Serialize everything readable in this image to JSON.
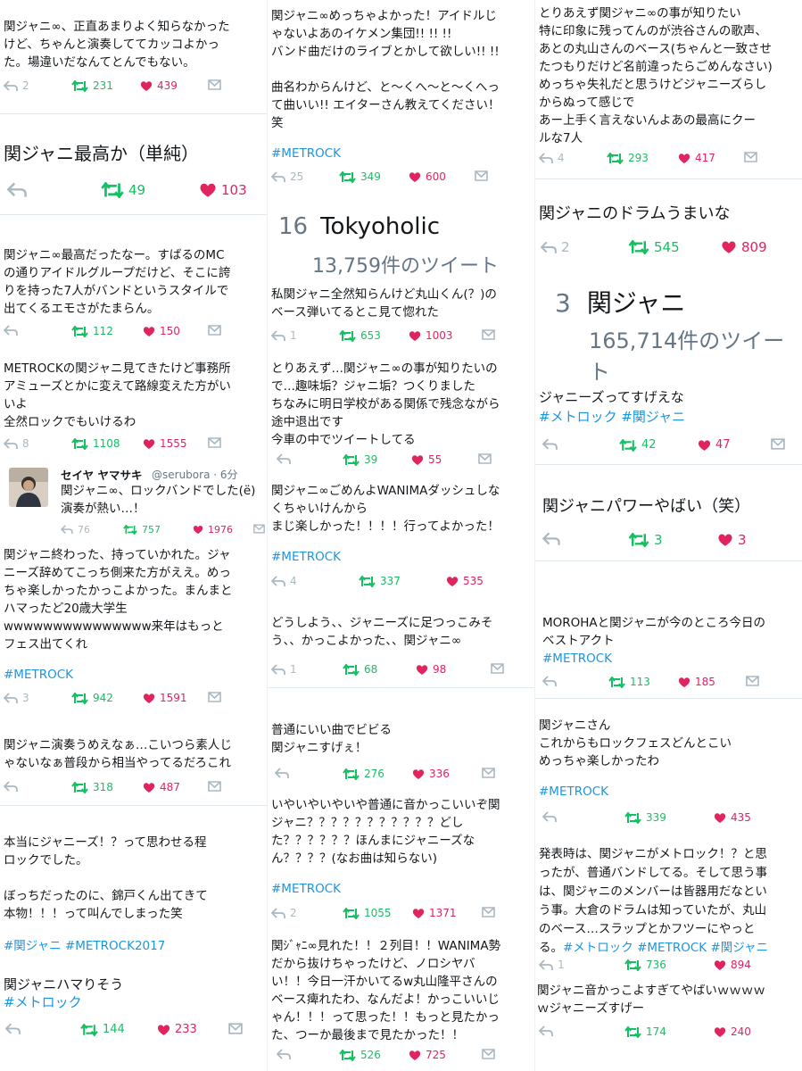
{
  "icons": {
    "reply": "reply-icon",
    "retweet": "retweet-icon",
    "like": "heart-icon",
    "dm": "envelope-icon"
  },
  "colors": {
    "retweet": "#17bf63",
    "like": "#e0245e",
    "hashtag": "#1b95e0",
    "muted": "#aab8c2"
  },
  "columns": [
    {
      "tweets": [
        {
          "text": "関ジャニ∞、正直あまりよく知らなかった\nけど、ちゃんと演奏しててカッコよかっ\nた。場違いだなんてとんでもない。",
          "hashtags": "",
          "reply": "2",
          "retweets": "231",
          "likes": "439"
        },
        {
          "text": "関ジャニ最高か（単純）",
          "hashtags": "",
          "reply": "",
          "retweets": "49",
          "likes": "103"
        },
        {
          "text": "関ジャニ∞最高だったなー。すばるのMC\nの通りアイドルグループだけど、そこに誇\nりを持った7人がバンドというスタイルで\n出てくるエモさがたまらん。",
          "hashtags": "",
          "reply": "",
          "retweets": "112",
          "likes": "150"
        },
        {
          "text": "METROCKの関ジャニ見てきたけど事務所\nアミューズとかに変えて路線変えた方がい\nいよ\n全然ロックでもいけるわ",
          "hashtags": "",
          "reply": "8",
          "retweets": "1108",
          "likes": "1555"
        },
        {
          "user_name": "セイヤ ヤマサキ",
          "user_handle": "@serubora · 6分",
          "text": "関ジャニ∞、ロックバンドでした(ё)\n演奏が熱い…！",
          "hashtags": "",
          "reply": "76",
          "retweets": "757",
          "likes": "1976"
        },
        {
          "text": "関ジャニ終わった、持っていかれた。ジャ\nニーズ辞めてこっち側来た方がええ。めっ\nちゃ楽しかったかっこよかった。まんまと\nハマったど20歳大学生\nwwwwwwwwwwwwwww来年はもっと\nフェス出てくれ",
          "hashtags": "#METROCK",
          "reply": "3",
          "retweets": "942",
          "likes": "1591"
        },
        {
          "text": "関ジャニ演奏うめえなぁ…こいつら素人じ\nゃないなぁ普段から相当やってるだろこれ",
          "hashtags": "",
          "reply": "",
          "retweets": "318",
          "likes": "487"
        },
        {
          "text": "本当にジャニーズ！？って思わせる程\nロックでした。\n\nぼっちだったのに、錦戸くん出てきて\n本物！！！って叫んでしまった笑",
          "hashtags": "#関ジャニ #METROCK2017",
          "reply": "",
          "retweets": "",
          "likes": ""
        },
        {
          "text": "関ジャニハマりそう",
          "hashtags": "#メトロック",
          "reply": "",
          "retweets": "144",
          "likes": "233"
        }
      ]
    },
    {
      "tweets": [
        {
          "text": "関ジャニ∞めっちゃよかった！アイドルじ\nゃないよあのイケメン集団!! !! !!\nバンド曲だけのライブとかして欲しい!! !!\n\n曲名わからんけど、と〜くへ〜と〜くへっ\nて曲いい!! エイターさん教えてください！\n笑",
          "hashtags": "#METROCK",
          "reply": "25",
          "retweets": "349",
          "likes": "600"
        },
        {
          "trend_rank": "16",
          "trend_name": "Tokyoholic",
          "trend_count": "13,759件のツイート"
        },
        {
          "text": "私関ジャニ全然知らんけど丸山くん(？)の\nベース弾いてるとこ見て惚れた",
          "hashtags": "",
          "reply": "1",
          "retweets": "653",
          "likes": "1003"
        },
        {
          "text": "とりあえず…関ジャニ∞の事が知りたいの\nで…趣味垢？ジャニ垢？つくりました\nちなみに明日学校がある関係で残念ながら\n途中退出です\n今車の中でツイートしてる",
          "hashtags": "",
          "reply": "",
          "retweets": "39",
          "likes": "55"
        },
        {
          "text": "関ジャニ∞ごめんよWANIMAダッシュしな\nくちゃいけんから\nまじ楽しかった！！！！行ってよかった！",
          "hashtags": "#METROCK",
          "reply": "4",
          "retweets": "337",
          "likes": "535"
        },
        {
          "text": "どうしよう、、ジャニーズに足つっこみそ\nう、、かっこよかった、、関ジャニ∞",
          "hashtags": "",
          "reply": "1",
          "retweets": "68",
          "likes": "98"
        },
        {
          "text": "普通にいい曲でビビる\n関ジャニすげぇ！",
          "hashtags": "",
          "reply": "",
          "retweets": "276",
          "likes": "336"
        },
        {
          "text": "いやいやいやいや普通に音かっこいいぞ関\nジャニ？？？？？？？？？？？どし\nた？？？？？？ほんまにジャニーズな\nん？？？？(なお曲は知らない)",
          "hashtags": "#METROCK",
          "reply": "2",
          "retweets": "1055",
          "likes": "1371"
        },
        {
          "text": "関ｼﾞｬﾆ∞見れた！！２列目！！WANIMA勢\nだから抜けちゃったけど、ノロシヤバ\nい！！今日一汗かいてるw丸山隆平さんの\nベース痺れたわ、なんだよ！かっこいいじ\nゃん！！！って思った！！もっと見たかっ\nた、つーか最後まで見たかった！！",
          "hashtags": "",
          "reply": "",
          "retweets": "526",
          "likes": "725"
        }
      ]
    },
    {
      "tweets": [
        {
          "text": "とりあえず関ジャニ∞の事が知りたい\n特に印象に残ってんのが渋谷さんの歌声、\nあとの丸山さんのベース(ちゃんと一致させ\nたつもりだけど名前違ったらごめんなさい)\nめっちゃ失礼だと思うけどジャニーズらし\nからぬって感じで\nあー上手く言えないんよあの最高にクー\nルな7人",
          "hashtags": "",
          "reply": "4",
          "retweets": "293",
          "likes": "417"
        },
        {
          "text": "関ジャニのドラムうまいな",
          "hashtags": "",
          "reply": "2",
          "retweets": "545",
          "likes": "809"
        },
        {
          "trend_rank": "3",
          "trend_name": "関ジャニ",
          "trend_count": "165,714件のツイート"
        },
        {
          "text": "ジャニーズってすげえな",
          "hashtags": "#メトロック #関ジャニ",
          "reply": "",
          "retweets": "42",
          "likes": "47"
        },
        {
          "text": "関ジャニパワーやばい（笑）",
          "hashtags": "",
          "reply": "",
          "retweets": "3",
          "likes": "3"
        },
        {
          "text": "MOROHAと関ジャニが今のところ今日の\nベストアクト",
          "hashtags": "#METROCK",
          "reply": "",
          "retweets": "113",
          "likes": "185"
        },
        {
          "text": "関ジャニさん\nこれからもロックフェスどんとこい\nめっちゃ楽しかったわ",
          "hashtags": "#METROCK",
          "reply": "",
          "retweets": "339",
          "likes": "435"
        },
        {
          "text": "発表時は、関ジャニがメトロック！？と思\nったが、普通バンドしてる。そして思う事\nは、関ジャニのメンバーは皆器用だなとい\nう事。大倉のドラムは知っていたが、丸山\nのベース…スラップとかフツーにやっと\nる。",
          "hashtags": "#メトロック #METROCK #関ジャニ",
          "reply": "1",
          "retweets": "736",
          "likes": "894"
        },
        {
          "text": "関ジャニ音かっこよすぎてやばいｗｗｗｗ\nｗジャニーズすげー",
          "hashtags": "",
          "reply": "",
          "retweets": "174",
          "likes": "240"
        }
      ]
    }
  ]
}
